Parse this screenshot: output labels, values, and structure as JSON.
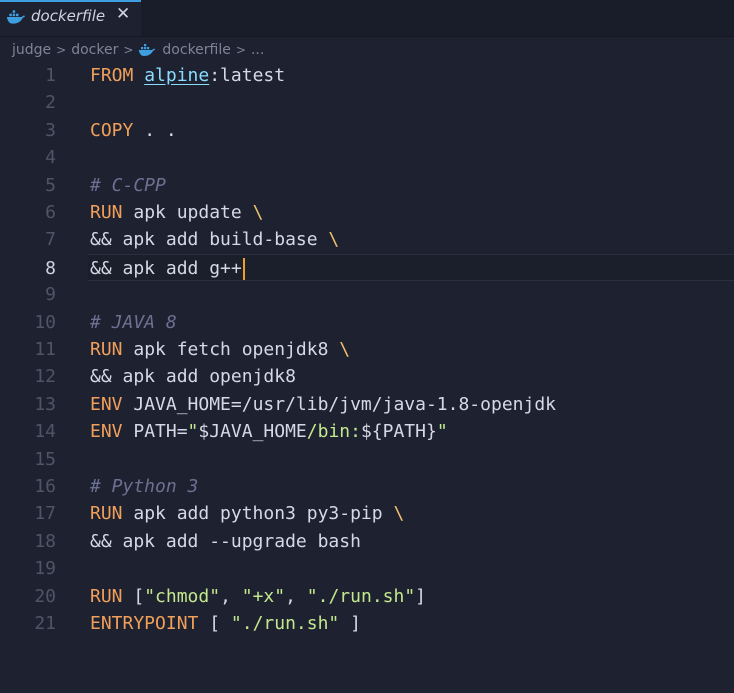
{
  "tab": {
    "title": "dockerfile",
    "close_glyph": "✕",
    "icon": "docker-whale-icon",
    "accent_color": "#3e9fe0"
  },
  "breadcrumb": {
    "items": [
      "judge",
      "docker",
      "dockerfile",
      "..."
    ],
    "separator": ">"
  },
  "editor": {
    "current_line": 8,
    "lines": [
      {
        "n": "1",
        "tokens": [
          {
            "t": "FROM ",
            "c": "kw"
          },
          {
            "t": "alpine",
            "c": "img"
          },
          {
            "t": ":latest",
            "c": "txt"
          }
        ]
      },
      {
        "n": "2",
        "tokens": []
      },
      {
        "n": "3",
        "tokens": [
          {
            "t": "COPY",
            "c": "kw"
          },
          {
            "t": " . .",
            "c": "txt"
          }
        ]
      },
      {
        "n": "4",
        "tokens": []
      },
      {
        "n": "5",
        "tokens": [
          {
            "t": "# C-CPP",
            "c": "cmt"
          }
        ]
      },
      {
        "n": "6",
        "tokens": [
          {
            "t": "RUN",
            "c": "kw"
          },
          {
            "t": " apk update ",
            "c": "txt"
          },
          {
            "t": "\\",
            "c": "cont"
          }
        ]
      },
      {
        "n": "7",
        "tokens": [
          {
            "t": "&& apk add build-base ",
            "c": "txt"
          },
          {
            "t": "\\",
            "c": "cont"
          }
        ]
      },
      {
        "n": "8",
        "tokens": [
          {
            "t": "&& apk add g++",
            "c": "txt"
          }
        ]
      },
      {
        "n": "9",
        "tokens": []
      },
      {
        "n": "10",
        "tokens": [
          {
            "t": "# JAVA 8",
            "c": "cmt"
          }
        ]
      },
      {
        "n": "11",
        "tokens": [
          {
            "t": "RUN",
            "c": "kw"
          },
          {
            "t": " apk fetch openjdk8 ",
            "c": "txt"
          },
          {
            "t": "\\",
            "c": "cont"
          }
        ]
      },
      {
        "n": "12",
        "tokens": [
          {
            "t": "&& apk add openjdk8",
            "c": "txt"
          }
        ]
      },
      {
        "n": "13",
        "tokens": [
          {
            "t": "ENV",
            "c": "kw"
          },
          {
            "t": " JAVA_HOME",
            "c": "txt"
          },
          {
            "t": "=/usr/lib/jvm/java-1.8-openjdk",
            "c": "txt"
          }
        ]
      },
      {
        "n": "14",
        "tokens": [
          {
            "t": "ENV",
            "c": "kw"
          },
          {
            "t": " PATH=",
            "c": "txt"
          },
          {
            "t": "\"",
            "c": "grn"
          },
          {
            "t": "$JAVA_HOME",
            "c": "txt"
          },
          {
            "t": "/bin:",
            "c": "grn"
          },
          {
            "t": "${PATH}",
            "c": "txt"
          },
          {
            "t": "\"",
            "c": "grn"
          }
        ]
      },
      {
        "n": "15",
        "tokens": []
      },
      {
        "n": "16",
        "tokens": [
          {
            "t": "# Python 3",
            "c": "cmt"
          }
        ]
      },
      {
        "n": "17",
        "tokens": [
          {
            "t": "RUN",
            "c": "kw"
          },
          {
            "t": " apk add python3 py3-pip ",
            "c": "txt"
          },
          {
            "t": "\\",
            "c": "cont"
          }
        ]
      },
      {
        "n": "18",
        "tokens": [
          {
            "t": "&& apk add --upgrade bash",
            "c": "txt"
          }
        ]
      },
      {
        "n": "19",
        "tokens": []
      },
      {
        "n": "20",
        "tokens": [
          {
            "t": "RUN",
            "c": "kw"
          },
          {
            "t": " [",
            "c": "txt"
          },
          {
            "t": "\"chmod\"",
            "c": "grn"
          },
          {
            "t": ", ",
            "c": "txt"
          },
          {
            "t": "\"+x\"",
            "c": "grn"
          },
          {
            "t": ", ",
            "c": "txt"
          },
          {
            "t": "\"./run.sh\"",
            "c": "grn"
          },
          {
            "t": "]",
            "c": "txt"
          }
        ]
      },
      {
        "n": "21",
        "tokens": [
          {
            "t": "ENTRYPOINT",
            "c": "kw"
          },
          {
            "t": " [ ",
            "c": "txt"
          },
          {
            "t": "\"./run.sh\"",
            "c": "grn"
          },
          {
            "t": " ]",
            "c": "txt"
          }
        ]
      }
    ]
  }
}
